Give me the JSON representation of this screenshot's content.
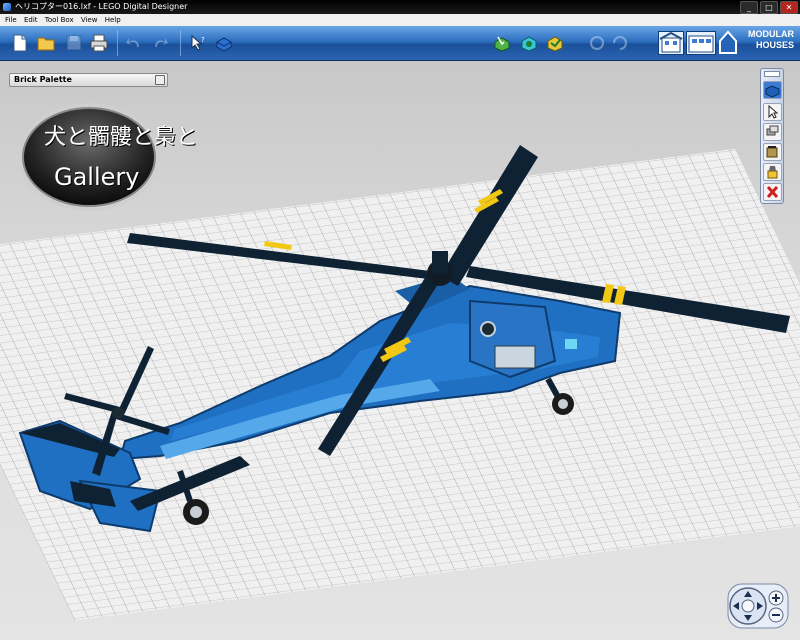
{
  "window": {
    "title": "ヘリコプター016.lxf - LEGO Digital Designer",
    "min": "_",
    "max": "□",
    "close": "✕"
  },
  "menu": [
    "File",
    "Edit",
    "Tool Box",
    "View",
    "Help"
  ],
  "toolbar": {
    "icons": [
      "new-file-icon",
      "open-folder-icon",
      "save-icon",
      "print-icon",
      "undo-icon",
      "redo-icon",
      "select-hint-icon",
      "brick-icon",
      "build-mode-icon",
      "view-mode-icon",
      "building-guide-mode-icon",
      "rotate-icon",
      "refresh-icon",
      "house-icon"
    ],
    "brand_line1": "MODULAR",
    "brand_line2": "HOUSES"
  },
  "palette": {
    "title": "Brick Palette"
  },
  "logo": {
    "line1": "犬と髑髏と梟と",
    "line2": "Gallery"
  },
  "side_tools": [
    "brick-icon",
    "cursor-icon",
    "clone-icon",
    "hinge-icon",
    "paint-icon",
    "delete-icon"
  ],
  "colors": {
    "toolbar_blue": "#2d6fc0",
    "model_blue": "#1f6fc2",
    "rotor_dark": "#0f2233",
    "stripe_yellow": "#f2c814"
  }
}
